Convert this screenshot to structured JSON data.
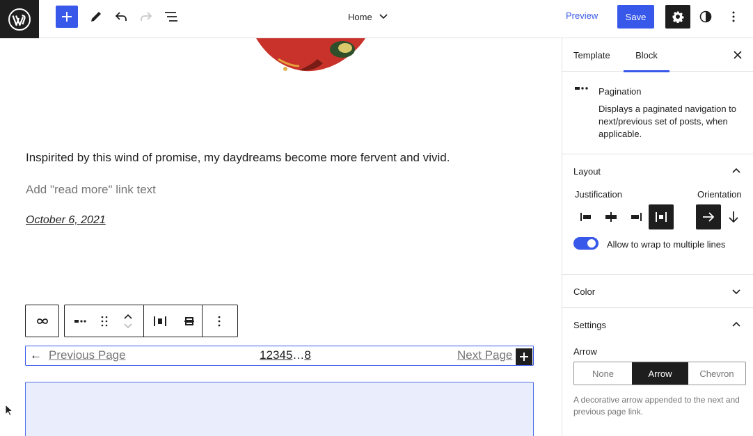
{
  "topbar": {
    "document_title": "Home",
    "preview_label": "Preview",
    "save_label": "Save"
  },
  "canvas": {
    "excerpt": "Inspirited by this wind of promise, my daydreams become more fervent and vivid.",
    "read_more_placeholder": "Add \"read more\" link text",
    "post_date": "October 6, 2021",
    "pagination": {
      "previous_label": "Previous Page",
      "next_label": "Next Page",
      "numbers": [
        "1",
        "2",
        "3",
        "4",
        "5",
        "…",
        "8"
      ]
    }
  },
  "sidebar": {
    "tabs": [
      {
        "label": "Template",
        "active": false
      },
      {
        "label": "Block",
        "active": true
      }
    ],
    "block_card": {
      "title": "Pagination",
      "description": "Displays a paginated navigation to next/previous set of posts, when applicable."
    },
    "layout": {
      "title": "Layout",
      "justification_label": "Justification",
      "orientation_label": "Orientation",
      "justification_selected": "space-between",
      "orientation_selected": "horizontal",
      "wrap_label": "Allow to wrap to multiple lines",
      "wrap_enabled": true
    },
    "color": {
      "title": "Color"
    },
    "settings": {
      "title": "Settings",
      "arrow_label": "Arrow",
      "options": [
        "None",
        "Arrow",
        "Chevron"
      ],
      "selected": "Arrow",
      "help": "A decorative arrow appended to the next and previous page link."
    }
  },
  "colors": {
    "accent": "#3858e9",
    "dark": "#1e1e1e",
    "muted": "#757575",
    "selection_bg": "#e9edfc"
  }
}
